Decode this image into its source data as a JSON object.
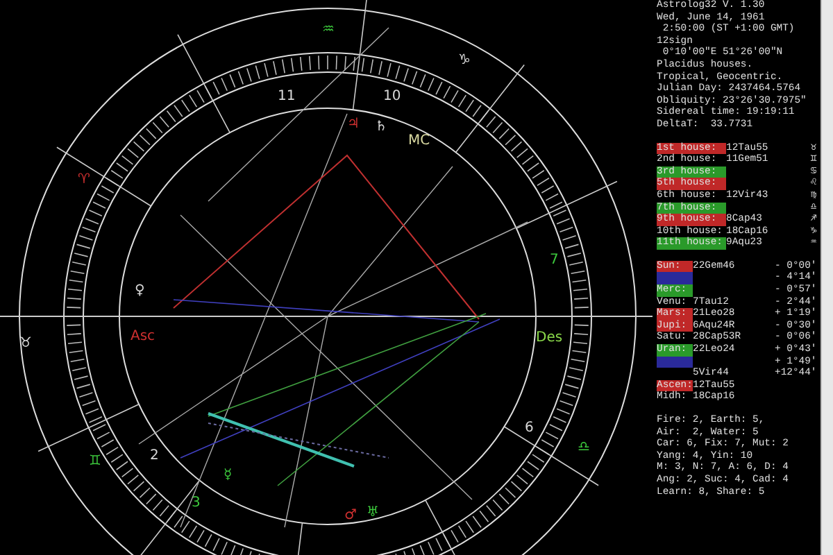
{
  "chart_labels": [
    {
      "text": "♒",
      "color": "#3cc83c"
    },
    {
      "text": "♑",
      "color": "#d8d8d8"
    },
    {
      "text": "♈",
      "color": "#d03030"
    },
    {
      "text": "♉",
      "color": "#d8d8d8"
    },
    {
      "text": "♊",
      "color": "#3cc83c"
    },
    {
      "text": "♎",
      "color": "#3cc83c"
    },
    {
      "text": "11",
      "color": "#d8d8d8"
    },
    {
      "text": "10",
      "color": "#d8d8d8"
    },
    {
      "text": "♃",
      "color": "#d03030"
    },
    {
      "text": "♄",
      "color": "#d8d8d8"
    },
    {
      "text": "MC",
      "color": "#d8d8a0"
    },
    {
      "text": "♀",
      "color": "#d8d8d8"
    },
    {
      "text": "Asc",
      "color": "#d03030"
    },
    {
      "text": "Des",
      "color": "#8ad84a"
    },
    {
      "text": "7",
      "color": "#3cc83c"
    },
    {
      "text": "6",
      "color": "#d8d8d8"
    },
    {
      "text": "2",
      "color": "#d8d8d8"
    },
    {
      "text": "3",
      "color": "#3cc83c"
    },
    {
      "text": "☿",
      "color": "#3cc83c"
    },
    {
      "text": "♂",
      "color": "#d03030"
    },
    {
      "text": "♅",
      "color": "#3cc83c"
    }
  ],
  "info_lines": [
    "Astrolog32 V. 1.30",
    "Wed, June 14, 1961",
    " 2:50:00 (ST +1:00 GMT)",
    "12sign",
    " 0°10'00\"E 51°26'00\"N",
    "Placidus houses.",
    "Tropical, Geocentric.",
    "Julian Day: 2437464.5764",
    "Obliquity: 23°26'30.7975\"",
    "Sidereal time: 19:19:11",
    "DeltaT:  33.7731"
  ],
  "houses": [
    {
      "label": "1st house:",
      "value": "12Tau55",
      "glyph": "♉",
      "color": "#c02828"
    },
    {
      "label": "2nd house:",
      "value": "11Gem51",
      "glyph": "♊"
    },
    {
      "label": "3rd house:",
      "glyph": "♋",
      "color": "#2a9a2a"
    },
    {
      "label": "5th house:",
      "glyph": "♌",
      "color": "#c02828"
    },
    {
      "label": "6th house:",
      "value": "12Vir43",
      "glyph": "♍"
    },
    {
      "label": "7th house:",
      "glyph": "♎",
      "color": "#2a9a2a"
    },
    {
      "label": "9th house:",
      "value": "8Cap43",
      "glyph": "♐",
      "color": "#c02828"
    },
    {
      "label": "10th house:",
      "value": "18Cap16",
      "glyph": "♑"
    },
    {
      "label": "11th house:",
      "value": "9Aqu23",
      "glyph": "♒",
      "color": "#2a9a2a"
    }
  ],
  "planets": [
    {
      "name": "Sun:",
      "position": "22Gem46",
      "offset": "- 0°00'",
      "color": "#c02828"
    },
    {
      "offset": "- 4°14'",
      "color": "#2a2a9a"
    },
    {
      "name": "Merc:",
      "offset": "- 0°57'",
      "color": "#2a9a2a"
    },
    {
      "name": "Venu:",
      "position": "7Tau12",
      "offset": "- 2°44'"
    },
    {
      "name": "Mars:",
      "position": "21Leo28",
      "offset": "+ 1°19'",
      "color": "#c02828"
    },
    {
      "name": "Jupi:",
      "position": "6Aqu24R",
      "offset": "- 0°30'",
      "color": "#c02828"
    },
    {
      "name": "Satu:",
      "position": "28Cap53R",
      "offset": "- 0°06'"
    },
    {
      "name": "Uran:",
      "position": "22Leo24",
      "offset": "+ 0°43'",
      "color": "#2a9a2a"
    },
    {
      "offset": "+ 1°49'",
      "color": "#2a2a9a"
    },
    {
      "position": "5Vir44",
      "offset": "+12°44'"
    },
    {
      "name": "Ascen:",
      "position": "12Tau55",
      "color": "#c02828"
    },
    {
      "name": "Midh:",
      "position": "18Cap16"
    }
  ],
  "stats_lines": [
    "Fire: 2, Earth: 5,",
    "Air:  2, Water: 5",
    "Car: 6, Fix: 7, Mut: 2",
    "Yang: 4, Yin: 10",
    "M: 3, N: 7, A: 6, D: 4",
    "Ang: 2, Suc: 4, Cad: 4",
    "Learn: 8, Share: 5"
  ]
}
